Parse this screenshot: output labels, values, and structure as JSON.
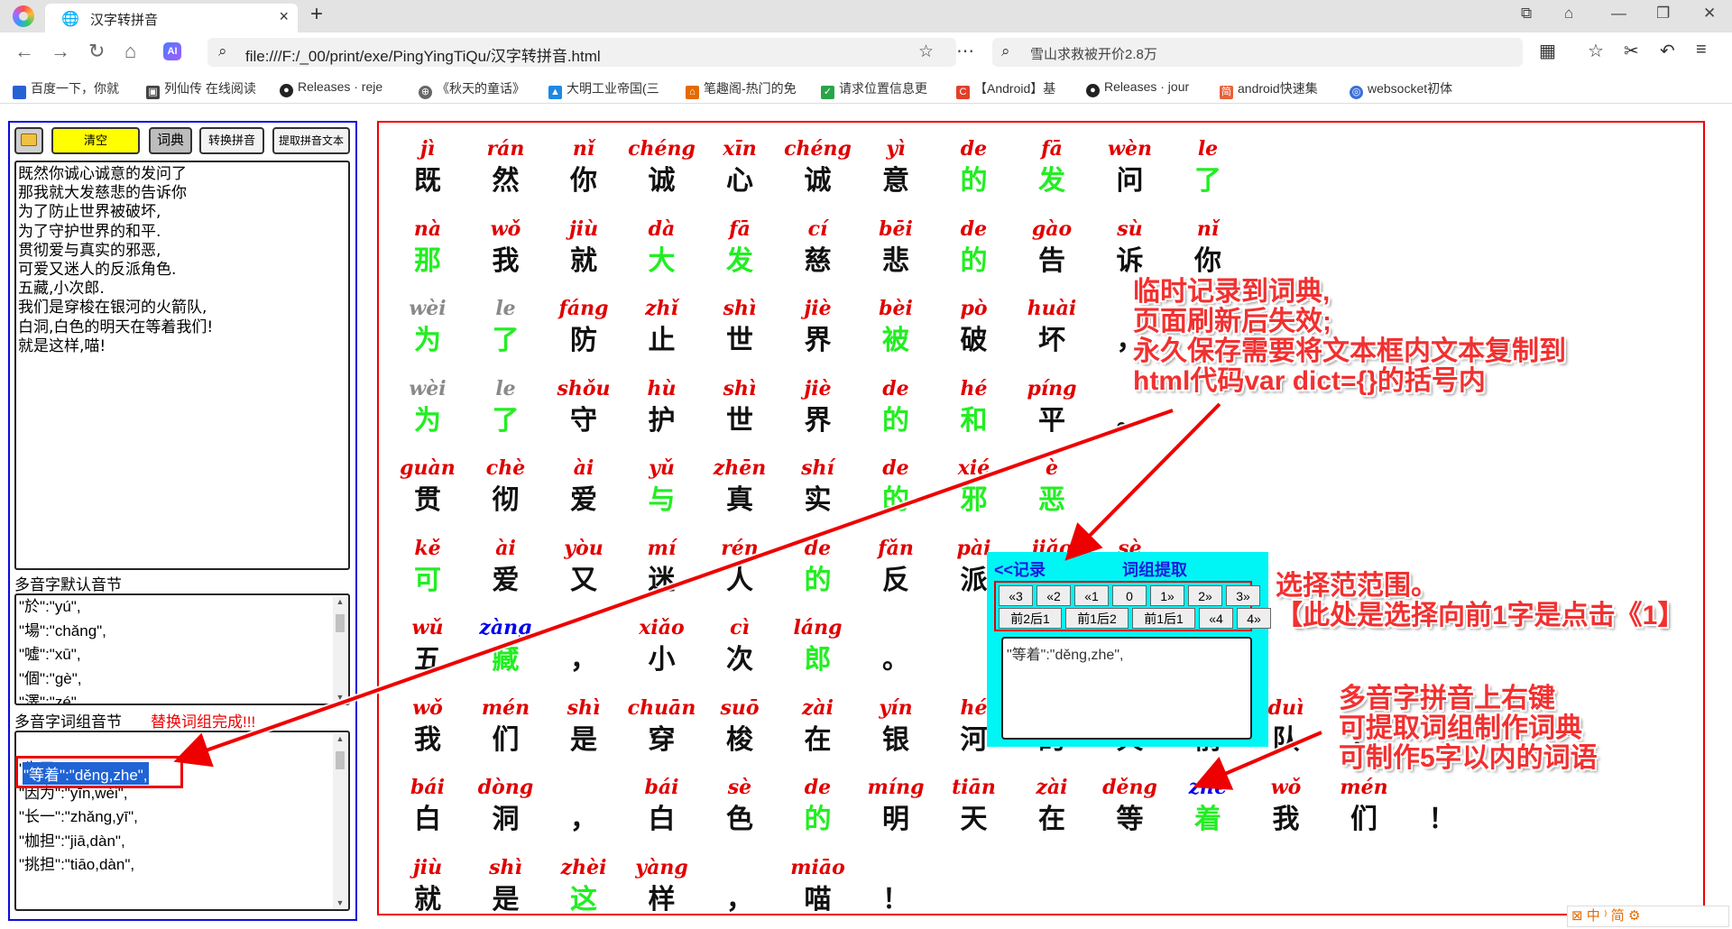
{
  "browser": {
    "tab_title": "汉字转拼音",
    "url": "file:///F:/_00/print/exe/PingYingTiQu/汉字转拼音.html",
    "search_text": "雪山求救被开价2.8万",
    "bookmarks": [
      "百度一下，你就",
      "列仙传 在线阅读",
      "Releases · reje",
      "《秋天的童话》",
      "大明工业帝国(三",
      "笔趣阁-热门的免",
      "请求位置信息更",
      "【Android】基",
      "Releases · jour",
      "android快速集",
      "websocket初体"
    ]
  },
  "toolbar": {
    "clear_label": "清空",
    "dict_label": "词典",
    "convert_label": "转换拼音",
    "extract_label": "提取拼音文本"
  },
  "input_text": "既然你诚心诚意的发问了\n那我就大发慈悲的告诉你\n为了防止世界被破坏,\n为了守护世界的和平.\n贯彻爱与真实的邪恶,\n可爱又迷人的反派角色.\n五藏,小次郎.\n我们是穿梭在银河的火箭队,\n白洞,白色的明天在等着我们!\n就是这样,喵!",
  "default_dict": {
    "label": "多音字默认音节",
    "lines": [
      "\"於\":\"yú\",",
      "\"場\":\"chǎng\",",
      "\"噓\":\"xū\",",
      "\"個\":\"gè\",",
      "\"澤\":\"zé\",",
      "\"嶄\":\"zhǎn\","
    ]
  },
  "phrase_dict": {
    "label": "多音字词组音节",
    "warning": "替换词组完成!!!",
    "selected": "\"等着\":\"děng,zhe\",",
    "lines": [
      "\"为了\":\"wèi,le\",",
      "\"因为\":\"yīn,wèi\",",
      "\"长一\":\"zhǎng,yī\",",
      "\"枷担\":\"jiā,dàn\",",
      "\"挑担\":\"tiāo,dàn\","
    ]
  },
  "colors": {
    "pinyin": "#e00000",
    "normal": "#111111",
    "variant": "#22ee22",
    "alt": "#0000ee",
    "gray": "#8a8a8a"
  },
  "rows": [
    [
      [
        "jì",
        "既",
        "n"
      ],
      [
        "rán",
        "然",
        "n"
      ],
      [
        "nǐ",
        "你",
        "n"
      ],
      [
        "chéng",
        "诚",
        "n"
      ],
      [
        "xīn",
        "心",
        "n"
      ],
      [
        "chéng",
        "诚",
        "n"
      ],
      [
        "yì",
        "意",
        "n"
      ],
      [
        "de",
        "的",
        "g"
      ],
      [
        "fā",
        "发",
        "g"
      ],
      [
        "wèn",
        "问",
        "n"
      ],
      [
        "le",
        "了",
        "g"
      ]
    ],
    [
      [
        "nà",
        "那",
        "g"
      ],
      [
        "wǒ",
        "我",
        "n"
      ],
      [
        "jiù",
        "就",
        "n"
      ],
      [
        "dà",
        "大",
        "g"
      ],
      [
        "fā",
        "发",
        "g"
      ],
      [
        "cí",
        "慈",
        "n"
      ],
      [
        "bēi",
        "悲",
        "n"
      ],
      [
        "de",
        "的",
        "g"
      ],
      [
        "gào",
        "告",
        "n"
      ],
      [
        "sù",
        "诉",
        "n"
      ],
      [
        "nǐ",
        "你",
        "n"
      ]
    ],
    [
      [
        "wèi",
        "为",
        "g",
        "gp"
      ],
      [
        "le",
        "了",
        "g",
        "gp"
      ],
      [
        "fáng",
        "防",
        "n"
      ],
      [
        "zhǐ",
        "止",
        "n"
      ],
      [
        "shì",
        "世",
        "n"
      ],
      [
        "jiè",
        "界",
        "n"
      ],
      [
        "bèi",
        "被",
        "g"
      ],
      [
        "pò",
        "破",
        "n"
      ],
      [
        "huài",
        "坏",
        "n"
      ],
      [
        "",
        "，",
        "n"
      ]
    ],
    [
      [
        "wèi",
        "为",
        "g",
        "gp"
      ],
      [
        "le",
        "了",
        "g",
        "gp"
      ],
      [
        "shǒu",
        "守",
        "n"
      ],
      [
        "hù",
        "护",
        "n"
      ],
      [
        "shì",
        "世",
        "n"
      ],
      [
        "jiè",
        "界",
        "n"
      ],
      [
        "de",
        "的",
        "g"
      ],
      [
        "hé",
        "和",
        "g"
      ],
      [
        "píng",
        "平",
        "n"
      ],
      [
        "",
        "。",
        "n"
      ]
    ],
    [
      [
        "guàn",
        "贯",
        "n"
      ],
      [
        "chè",
        "彻",
        "n"
      ],
      [
        "ài",
        "爱",
        "n"
      ],
      [
        "yǔ",
        "与",
        "g"
      ],
      [
        "zhēn",
        "真",
        "n"
      ],
      [
        "shí",
        "实",
        "n"
      ],
      [
        "de",
        "的",
        "g"
      ],
      [
        "xié",
        "邪",
        "g"
      ],
      [
        "è",
        "恶",
        "g"
      ]
    ],
    [
      [
        "kě",
        "可",
        "g"
      ],
      [
        "ài",
        "爱",
        "n"
      ],
      [
        "yòu",
        "又",
        "n"
      ],
      [
        "mí",
        "迷",
        "n"
      ],
      [
        "rén",
        "人",
        "n"
      ],
      [
        "de",
        "的",
        "g"
      ],
      [
        "fǎn",
        "反",
        "n"
      ],
      [
        "pài",
        "派",
        "n"
      ],
      [
        "jiǎo",
        "角",
        "n"
      ],
      [
        "sè",
        "色",
        "n"
      ]
    ],
    [
      [
        "wǔ",
        "五",
        "n"
      ],
      [
        "zàng",
        "藏",
        "g",
        "b"
      ],
      [
        "",
        "，",
        "n"
      ],
      [
        "xiǎo",
        "小",
        "n"
      ],
      [
        "cì",
        "次",
        "n"
      ],
      [
        "láng",
        "郎",
        "g"
      ],
      [
        "",
        "。",
        "n"
      ]
    ],
    [
      [
        "wǒ",
        "我",
        "n"
      ],
      [
        "mén",
        "们",
        "n"
      ],
      [
        "shì",
        "是",
        "n"
      ],
      [
        "chuān",
        "穿",
        "n"
      ],
      [
        "suō",
        "梭",
        "n"
      ],
      [
        "zài",
        "在",
        "n"
      ],
      [
        "yín",
        "银",
        "n"
      ],
      [
        "hé",
        "河",
        "n"
      ],
      [
        "de",
        "的",
        "n"
      ],
      [
        "huǒ",
        "火",
        "n"
      ],
      [
        "jiàn",
        "箭",
        "n"
      ],
      [
        "duì",
        "队",
        "n"
      ],
      [
        "",
        "，",
        "n"
      ]
    ],
    [
      [
        "bái",
        "白",
        "n"
      ],
      [
        "dòng",
        "洞",
        "n"
      ],
      [
        "",
        "，",
        "n"
      ],
      [
        "bái",
        "白",
        "n"
      ],
      [
        "sè",
        "色",
        "n"
      ],
      [
        "de",
        "的",
        "g"
      ],
      [
        "míng",
        "明",
        "n"
      ],
      [
        "tiān",
        "天",
        "n"
      ],
      [
        "zài",
        "在",
        "n"
      ],
      [
        "děng",
        "等",
        "n"
      ],
      [
        "zhe",
        "着",
        "g",
        "b"
      ],
      [
        "wǒ",
        "我",
        "n"
      ],
      [
        "mén",
        "们",
        "n"
      ],
      [
        "",
        "！",
        "n"
      ]
    ],
    [
      [
        "jiù",
        "就",
        "n"
      ],
      [
        "shì",
        "是",
        "n"
      ],
      [
        "zhèi",
        "这",
        "g"
      ],
      [
        "yàng",
        "样",
        "n"
      ],
      [
        "",
        "，",
        "n"
      ],
      [
        "miāo",
        "喵",
        "n"
      ],
      [
        "",
        "！",
        "n"
      ]
    ]
  ],
  "popup": {
    "record_label": "<<记录",
    "extract_label": "词组提取",
    "range_row1": [
      "«3",
      "«2",
      "«1",
      "0",
      "1»",
      "2»",
      "3»"
    ],
    "range_row2": [
      "前2后1",
      "前1后2",
      "前1后1",
      "«4",
      "4»"
    ],
    "textarea_value": "\"等着\":\"děng,zhe\","
  },
  "annotations": {
    "temp_record": "临时记录到词典,\n页面刷新后失效;\n永久保存需要将文本框内文本复制到\nhtml代码var dict={}的括号内",
    "select_range": "选择范范围。\n【此处是选择向前1字是点击《1】",
    "right_click": "多音字拼音上右键\n可提取词组制作词典\n可制作5字以内的词语"
  },
  "ime_text": "中 ⁾ 简"
}
